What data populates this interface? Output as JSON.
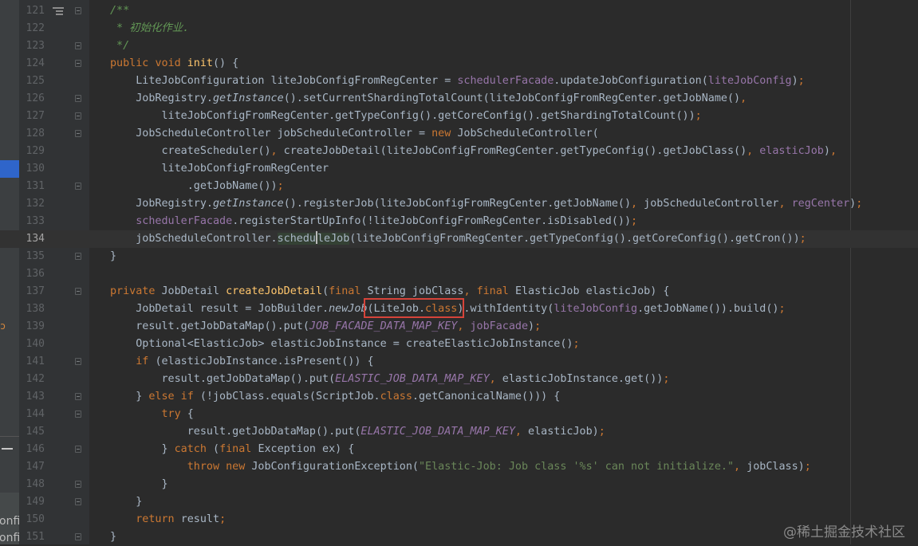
{
  "watermark": "@稀土掘金技术社区",
  "sidebar": {
    "cut_labels": [
      "onfi",
      "onfi"
    ]
  },
  "accent_colors": {
    "keyword": "#cc7832",
    "method": "#ffc66d",
    "field": "#9876aa",
    "string": "#6a8759",
    "comment": "#629755",
    "selection": "#2f65ca",
    "annotation_box": "#d6443a"
  },
  "icons": [
    "bookmark-icon",
    "fold-icon"
  ],
  "editor": {
    "current_line": 134,
    "lines": [
      {
        "n": "121",
        "fold": true,
        "bookmark": true,
        "tokens": [
          {
            "t": "/**",
            "c": "cmt"
          }
        ]
      },
      {
        "n": "122",
        "tokens": [
          {
            "t": " * 初始化作业.",
            "c": "cmt"
          }
        ]
      },
      {
        "n": "123",
        "fold": true,
        "tokens": [
          {
            "t": " */",
            "c": "cmt"
          }
        ]
      },
      {
        "n": "124",
        "fold": true,
        "tokens": [
          {
            "t": "public ",
            "c": "kw"
          },
          {
            "t": "void ",
            "c": "kw"
          },
          {
            "t": "init",
            "c": "fn"
          },
          {
            "t": "() {"
          }
        ]
      },
      {
        "n": "125",
        "tokens": [
          {
            "t": "    LiteJobConfiguration liteJobConfigFromRegCenter = "
          },
          {
            "t": "schedulerFacade",
            "c": "fld"
          },
          {
            "t": ".updateJobConfiguration("
          },
          {
            "t": "liteJobConfig",
            "c": "fld"
          },
          {
            "t": ")"
          },
          {
            "t": ";",
            "c": "kw"
          }
        ]
      },
      {
        "n": "126",
        "fold": true,
        "tokens": [
          {
            "t": "    JobRegistry."
          },
          {
            "t": "getInstance",
            "c": "it"
          },
          {
            "t": "().setCurrentShardingTotalCount(liteJobConfigFromRegCenter.getJobName()"
          },
          {
            "t": ",",
            "c": "kw"
          }
        ]
      },
      {
        "n": "127",
        "fold": true,
        "tokens": [
          {
            "t": "        liteJobConfigFromRegCenter.getTypeConfig().getCoreConfig().getShardingTotalCount())"
          },
          {
            "t": ";",
            "c": "kw"
          }
        ]
      },
      {
        "n": "128",
        "fold": true,
        "tokens": [
          {
            "t": "    JobScheduleController jobScheduleController = "
          },
          {
            "t": "new ",
            "c": "kw"
          },
          {
            "t": "JobScheduleController("
          }
        ]
      },
      {
        "n": "129",
        "tokens": [
          {
            "t": "        createScheduler()"
          },
          {
            "t": ", ",
            "c": "kw"
          },
          {
            "t": "createJobDetail(liteJobConfigFromRegCenter.getTypeConfig().getJobClass()"
          },
          {
            "t": ", ",
            "c": "kw"
          },
          {
            "t": "elasticJob",
            "c": "fld"
          },
          {
            "t": ")"
          },
          {
            "t": ",",
            "c": "kw"
          }
        ]
      },
      {
        "n": "130",
        "tokens": [
          {
            "t": "        liteJobConfigFromRegCenter"
          }
        ]
      },
      {
        "n": "131",
        "fold": true,
        "tokens": [
          {
            "t": "            .getJobName())"
          },
          {
            "t": ";",
            "c": "kw"
          }
        ]
      },
      {
        "n": "132",
        "tokens": [
          {
            "t": "    JobRegistry."
          },
          {
            "t": "getInstance",
            "c": "it"
          },
          {
            "t": "().registerJob(liteJobConfigFromRegCenter.getJobName()"
          },
          {
            "t": ", ",
            "c": "kw"
          },
          {
            "t": "jobScheduleController"
          },
          {
            "t": ", ",
            "c": "kw"
          },
          {
            "t": "regCenter",
            "c": "fld"
          },
          {
            "t": ")"
          },
          {
            "t": ";",
            "c": "kw"
          }
        ]
      },
      {
        "n": "133",
        "tokens": [
          {
            "t": "    "
          },
          {
            "t": "schedulerFacade",
            "c": "fld"
          },
          {
            "t": ".registerStartUpInfo(!liteJobConfigFromRegCenter.isDisabled())"
          },
          {
            "t": ";",
            "c": "kw"
          }
        ]
      },
      {
        "n": "134",
        "tokens": [
          {
            "t": "    jobScheduleController."
          },
          {
            "t": "schedu",
            "c": "usage"
          },
          {
            "caret": true
          },
          {
            "t": "leJob",
            "c": "usage"
          },
          {
            "t": "(liteJobConfigFromRegCenter.getTypeConfig().getCoreConfig().getCron())"
          },
          {
            "t": ";",
            "c": "kw"
          }
        ]
      },
      {
        "n": "135",
        "fold": true,
        "tokens": [
          {
            "t": "}"
          }
        ]
      },
      {
        "n": "136",
        "tokens": []
      },
      {
        "n": "137",
        "fold": true,
        "tokens": [
          {
            "t": "private ",
            "c": "kw"
          },
          {
            "t": "JobDetail "
          },
          {
            "t": "createJobDetail",
            "c": "fn"
          },
          {
            "t": "("
          },
          {
            "t": "final ",
            "c": "kw"
          },
          {
            "t": "String jobClass"
          },
          {
            "t": ", ",
            "c": "kw"
          },
          {
            "t": "final ",
            "c": "kw"
          },
          {
            "t": "ElasticJob elasticJob) {"
          }
        ]
      },
      {
        "n": "138",
        "tokens": [
          {
            "t": "    JobDetail result = JobBuilder."
          },
          {
            "t": "newJob",
            "c": "it"
          },
          {
            "t": "(LiteJob."
          },
          {
            "t": "class",
            "c": "kw"
          },
          {
            "t": ")."
          },
          {
            "t": "withIdentity("
          },
          {
            "t": "liteJobConfig",
            "c": "fld"
          },
          {
            "t": ".getJobName()).build()"
          },
          {
            "t": ";",
            "c": "kw"
          }
        ]
      },
      {
        "n": "139",
        "tokens": [
          {
            "t": "    result.getJobDataMap().put("
          },
          {
            "t": "JOB_FACADE_DATA_MAP_KEY",
            "c": "cst"
          },
          {
            "t": ", ",
            "c": "kw"
          },
          {
            "t": "jobFacade",
            "c": "fld"
          },
          {
            "t": ")"
          },
          {
            "t": ";",
            "c": "kw"
          }
        ]
      },
      {
        "n": "140",
        "tokens": [
          {
            "t": "    Optional<ElasticJob> elasticJobInstance = createElasticJobInstance()"
          },
          {
            "t": ";",
            "c": "kw"
          }
        ]
      },
      {
        "n": "141",
        "fold": true,
        "tokens": [
          {
            "t": "    "
          },
          {
            "t": "if ",
            "c": "kw"
          },
          {
            "t": "(elasticJobInstance.isPresent()) {"
          }
        ]
      },
      {
        "n": "142",
        "tokens": [
          {
            "t": "        result.getJobDataMap().put("
          },
          {
            "t": "ELASTIC_JOB_DATA_MAP_KEY",
            "c": "cst"
          },
          {
            "t": ", ",
            "c": "kw"
          },
          {
            "t": "elasticJobInstance.get())"
          },
          {
            "t": ";",
            "c": "kw"
          }
        ]
      },
      {
        "n": "143",
        "fold": true,
        "tokens": [
          {
            "t": "    } "
          },
          {
            "t": "else if ",
            "c": "kw"
          },
          {
            "t": "(!jobClass.equals(ScriptJob."
          },
          {
            "t": "class",
            "c": "kw"
          },
          {
            "t": ".getCanonicalName())) {"
          }
        ]
      },
      {
        "n": "144",
        "fold": true,
        "tokens": [
          {
            "t": "        "
          },
          {
            "t": "try ",
            "c": "kw"
          },
          {
            "t": "{"
          }
        ]
      },
      {
        "n": "145",
        "tokens": [
          {
            "t": "            result.getJobDataMap().put("
          },
          {
            "t": "ELASTIC_JOB_DATA_MAP_KEY",
            "c": "cst"
          },
          {
            "t": ", ",
            "c": "kw"
          },
          {
            "t": "elasticJob)"
          },
          {
            "t": ";",
            "c": "kw"
          }
        ]
      },
      {
        "n": "146",
        "fold": true,
        "tokens": [
          {
            "t": "        } "
          },
          {
            "t": "catch ",
            "c": "kw"
          },
          {
            "t": "("
          },
          {
            "t": "final ",
            "c": "kw"
          },
          {
            "t": "Exception ex) {"
          }
        ]
      },
      {
        "n": "147",
        "tokens": [
          {
            "t": "            "
          },
          {
            "t": "throw new ",
            "c": "kw"
          },
          {
            "t": "JobConfigurationException("
          },
          {
            "t": "\"Elastic-Job: Job class '%s' can not initialize.\"",
            "c": "str"
          },
          {
            "t": ", ",
            "c": "kw"
          },
          {
            "t": "jobClass)"
          },
          {
            "t": ";",
            "c": "kw"
          }
        ]
      },
      {
        "n": "148",
        "fold": true,
        "tokens": [
          {
            "t": "        }"
          }
        ]
      },
      {
        "n": "149",
        "fold": true,
        "tokens": [
          {
            "t": "    }"
          }
        ]
      },
      {
        "n": "150",
        "tokens": [
          {
            "t": "    "
          },
          {
            "t": "return ",
            "c": "kw"
          },
          {
            "t": "result"
          },
          {
            "t": ";",
            "c": "kw"
          }
        ]
      },
      {
        "n": "151",
        "fold": true,
        "tokens": [
          {
            "t": "}"
          }
        ]
      }
    ]
  }
}
